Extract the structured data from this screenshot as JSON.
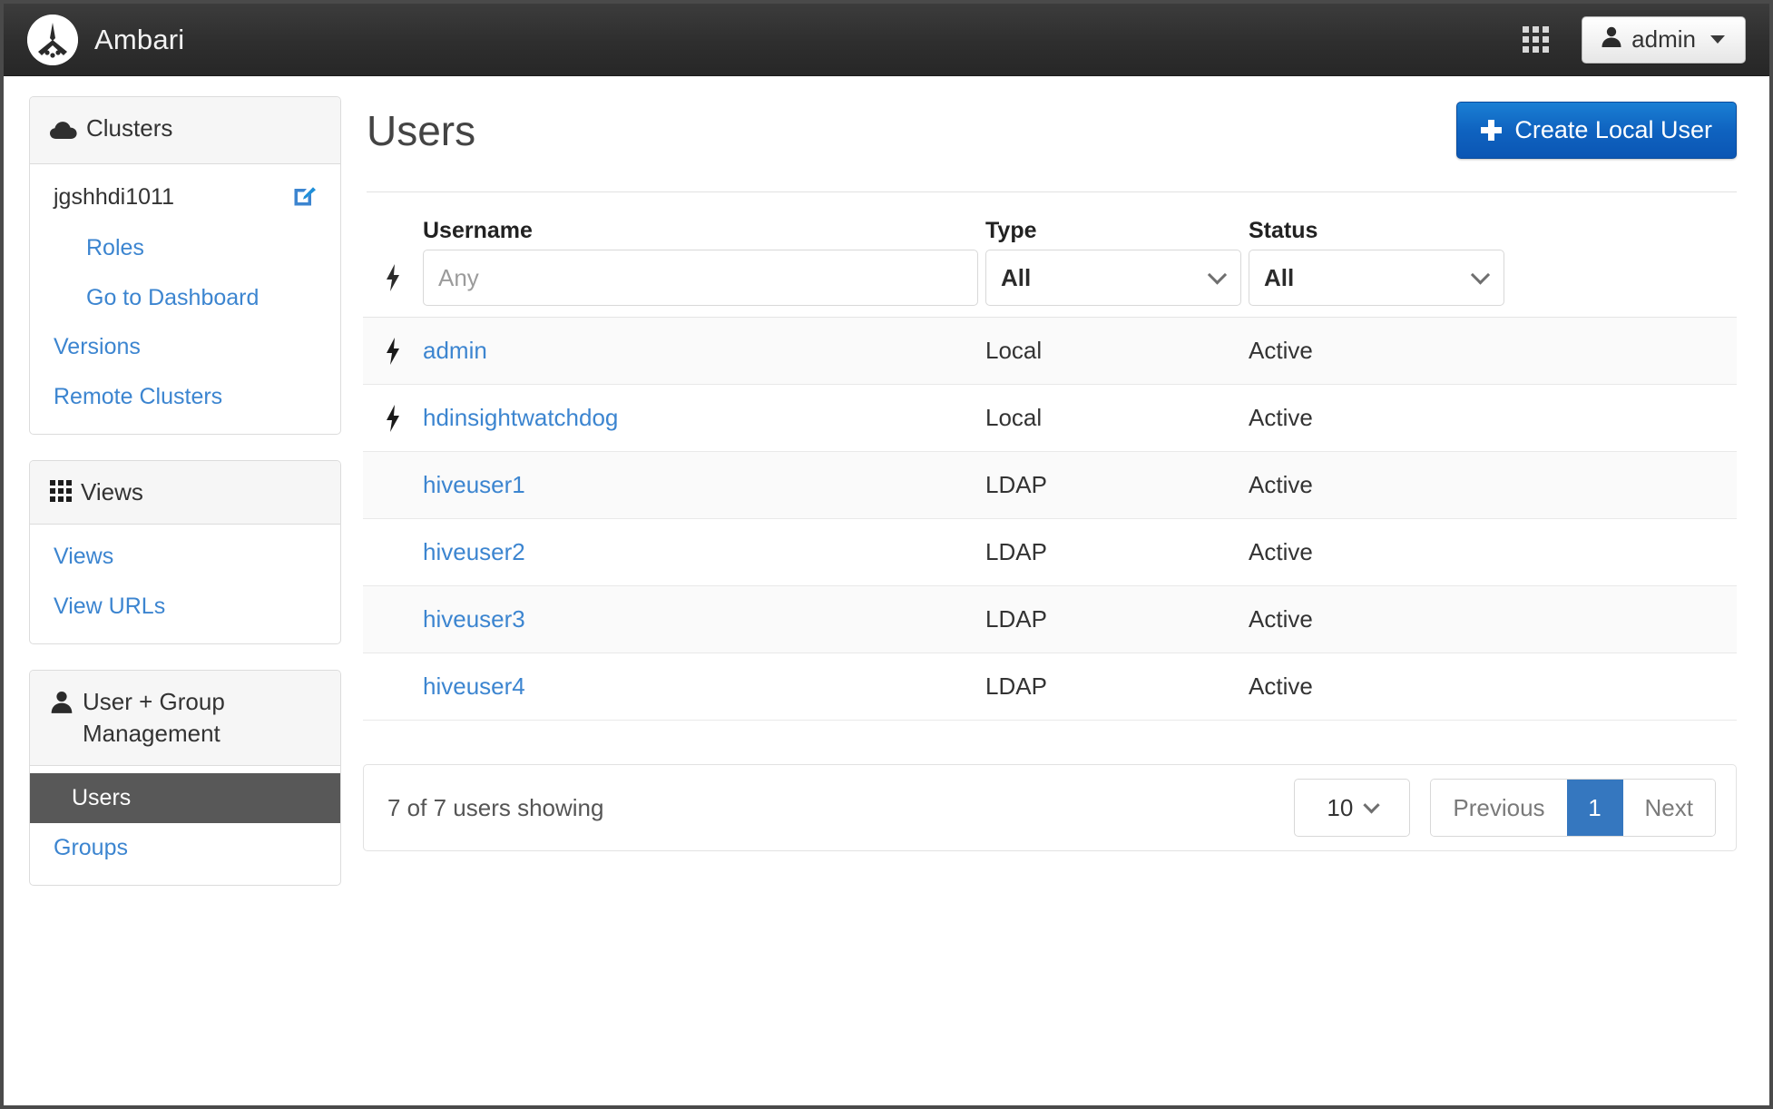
{
  "navbar": {
    "brand": "Ambari",
    "logo_icon": "ambari-logo-icon",
    "apps_grid_icon": "apps-grid-icon",
    "user_menu": {
      "label": "admin",
      "user_icon": "user-icon",
      "caret_icon": "caret-down-icon"
    }
  },
  "sidebar": {
    "panels": [
      {
        "title": "Clusters",
        "icon": "cloud-icon",
        "cluster": {
          "name": "jgshhdi1011",
          "edit_icon": "edit-pencil-icon"
        },
        "items": [
          {
            "label": "Roles",
            "indent": true,
            "active": false
          },
          {
            "label": "Go to Dashboard",
            "indent": true,
            "active": false
          },
          {
            "label": "Versions",
            "indent": false,
            "active": false
          },
          {
            "label": "Remote Clusters",
            "indent": false,
            "active": false
          }
        ]
      },
      {
        "title": "Views",
        "icon": "views-grid-icon",
        "items": [
          {
            "label": "Views",
            "indent": false,
            "active": false
          },
          {
            "label": "View URLs",
            "indent": false,
            "active": false
          }
        ]
      },
      {
        "title": "User + Group Management",
        "icon": "user-icon",
        "items": [
          {
            "label": "Users",
            "indent": false,
            "active": true
          },
          {
            "label": "Groups",
            "indent": false,
            "active": false
          }
        ]
      }
    ]
  },
  "main": {
    "title": "Users",
    "create_button": {
      "label": "Create Local User",
      "icon": "plus-icon"
    },
    "table": {
      "columns": [
        "Username",
        "Type",
        "Status"
      ],
      "filters": {
        "username_placeholder": "Any",
        "username_value": "",
        "type_value": "All",
        "status_value": "All"
      },
      "rows": [
        {
          "flash": true,
          "username": "admin",
          "type": "Local",
          "status": "Active"
        },
        {
          "flash": true,
          "username": "hdinsightwatchdog",
          "type": "Local",
          "status": "Active"
        },
        {
          "flash": false,
          "username": "hiveuser1",
          "type": "LDAP",
          "status": "Active"
        },
        {
          "flash": false,
          "username": "hiveuser2",
          "type": "LDAP",
          "status": "Active"
        },
        {
          "flash": false,
          "username": "hiveuser3",
          "type": "LDAP",
          "status": "Active"
        },
        {
          "flash": false,
          "username": "hiveuser4",
          "type": "LDAP",
          "status": "Active"
        }
      ]
    },
    "footer": {
      "showing": "7 of 7 users showing",
      "page_size": "10",
      "previous_label": "Previous",
      "current_page": "1",
      "next_label": "Next"
    }
  },
  "colors": {
    "link_blue": "#3c85d0",
    "primary_button": "#0f63c0",
    "active_green": "#3c763d",
    "selected_item_bg": "#585858",
    "navbar_bg": "#2e2e2e",
    "pager_active_bg": "#3577bf"
  }
}
